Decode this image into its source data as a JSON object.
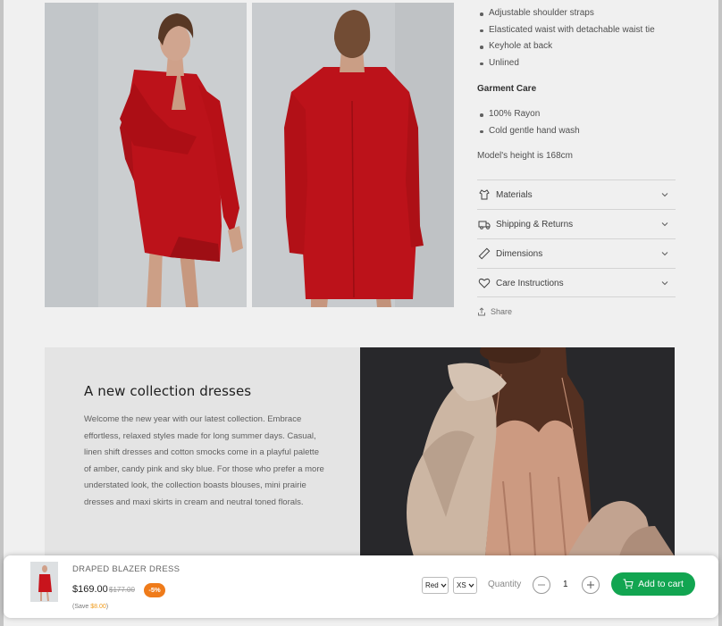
{
  "product": {
    "feature_bullets": [
      "Adjustable shoulder straps",
      "Elasticated waist with detachable waist tie",
      "Keyhole at back",
      "Unlined"
    ],
    "garment_care_heading": "Garment Care",
    "care_bullets": [
      "100% Rayon",
      "Cold gentle hand wash"
    ],
    "model_height": "Model's height is 168cm",
    "accordions": [
      {
        "label": "Materials",
        "icon": "hanger-icon"
      },
      {
        "label": "Shipping & Returns",
        "icon": "truck-icon"
      },
      {
        "label": "Dimensions",
        "icon": "ruler-icon"
      },
      {
        "label": "Care Instructions",
        "icon": "heart-icon"
      }
    ],
    "share_label": "Share",
    "images": [
      {
        "icon": "model-front-photo"
      },
      {
        "icon": "model-back-photo"
      }
    ]
  },
  "banner": {
    "title": "A new collection dresses",
    "text": "Welcome the new year with our latest collection. Embrace effortless, relaxed styles made for long summer days. Casual, linen shift dresses and cotton smocks come in a playful palette of amber, candy pink and sky blue. For those who prefer a more understated look, the collection boasts blouses, mini prairie dresses and maxi skirts in cream and neutral toned florals."
  },
  "sticky_cart": {
    "name": "DRAPED BLAZER DRESS",
    "price": "$169.00",
    "compare_price": "$177.00",
    "badge": "-5%",
    "save_prefix": "(Save ",
    "save_amount": "$8.00",
    "save_suffix": ")",
    "color_value": "Red",
    "size_value": "XS",
    "quantity_label": "Quantity",
    "quantity": "1",
    "add_to_cart_label": "Add to cart"
  },
  "colors": {
    "accent_green": "#12a551",
    "badge_orange": "#ef7b1a",
    "dress_red": "#c8141c"
  }
}
